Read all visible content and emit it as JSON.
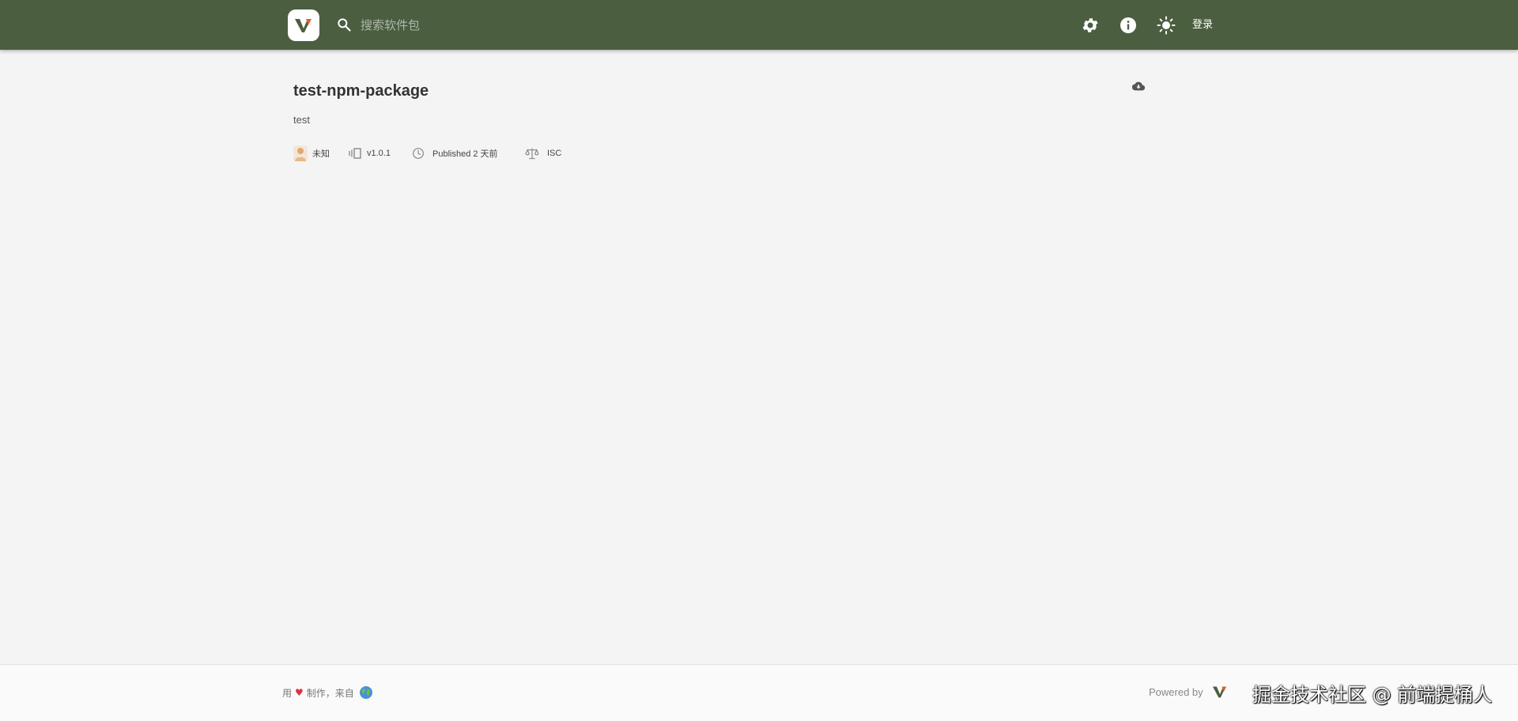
{
  "header": {
    "search_placeholder": "搜索软件包",
    "login_label": "登录",
    "bg_color": "#4b5e40"
  },
  "package": {
    "name": "test-npm-package",
    "description": "test",
    "author": "未知",
    "version": "v1.0.1",
    "published": "Published 2 天前",
    "license": "ISC"
  },
  "footer": {
    "made_with_prefix": "用",
    "made_with_suffix": "制作，来自",
    "powered_by": "Powered by"
  },
  "watermark": "掘金技术社区 @ 前端提桶人",
  "icons": {
    "logo": "verdaccio-logo",
    "search": "search-icon",
    "settings": "gear-icon",
    "info": "info-icon",
    "theme": "sun-icon",
    "download": "cloud-download-icon"
  }
}
